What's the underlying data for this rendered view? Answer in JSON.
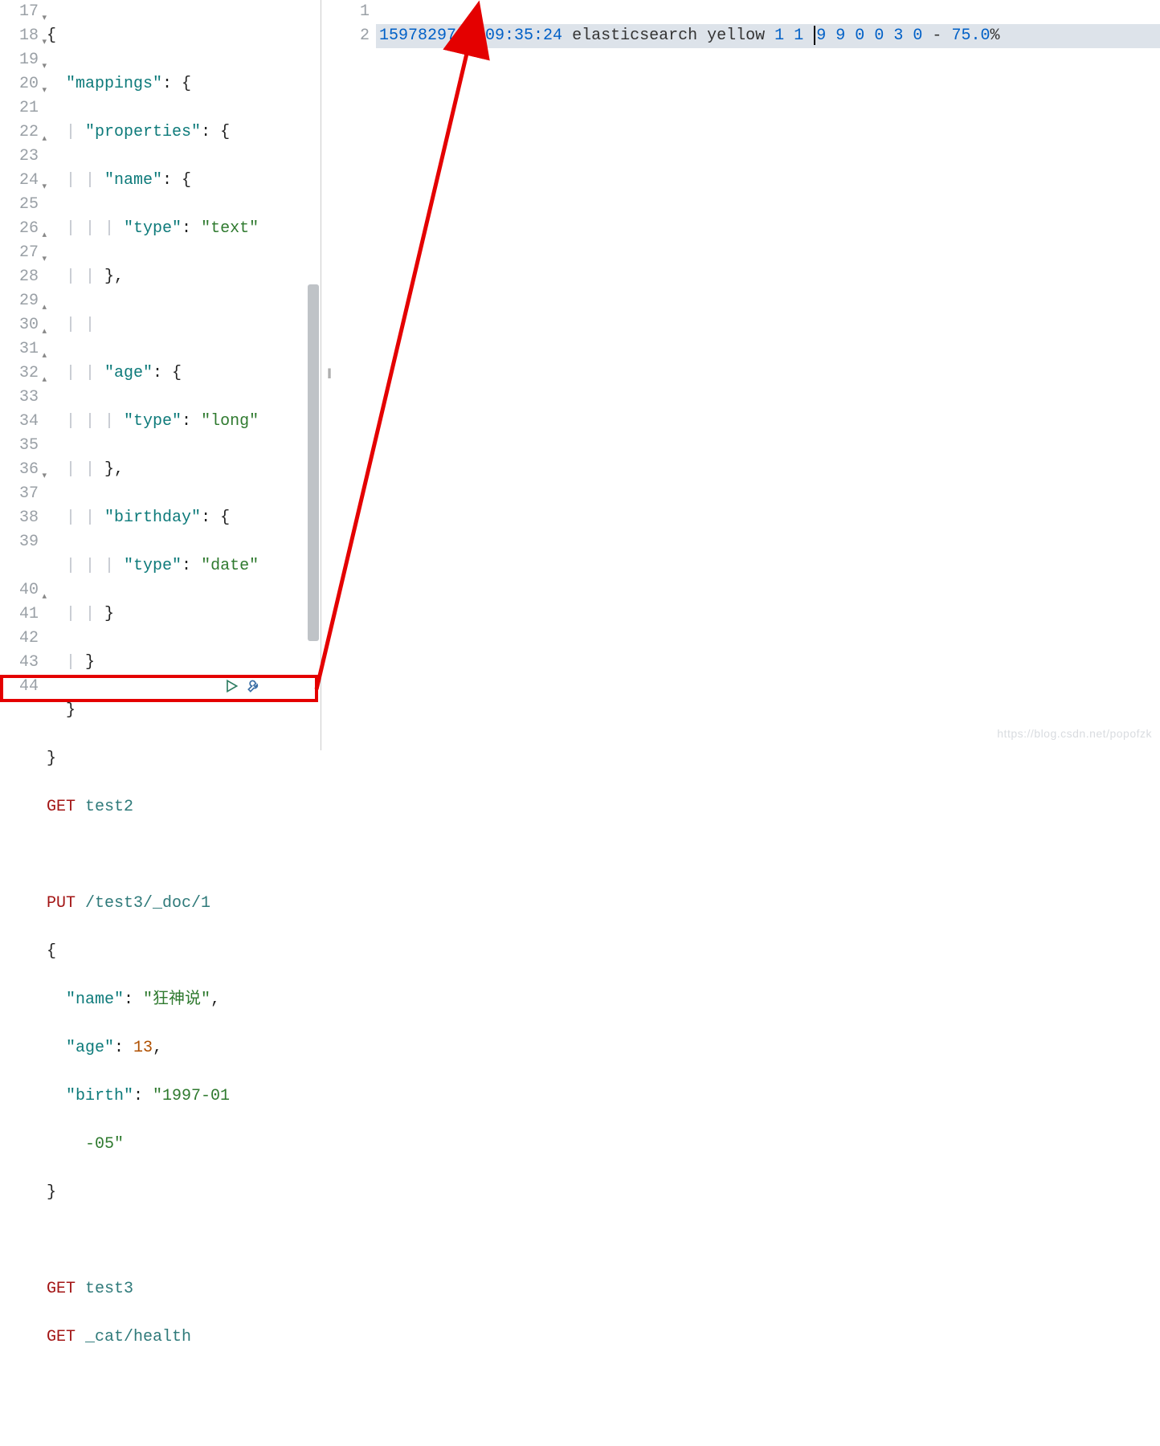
{
  "left": {
    "gutter": [
      {
        "n": "17",
        "fold": "▾"
      },
      {
        "n": "18",
        "fold": "▾"
      },
      {
        "n": "19",
        "fold": "▾"
      },
      {
        "n": "20",
        "fold": "▾"
      },
      {
        "n": "21",
        "fold": ""
      },
      {
        "n": "22",
        "fold": "▴"
      },
      {
        "n": "23",
        "fold": ""
      },
      {
        "n": "24",
        "fold": "▾"
      },
      {
        "n": "25",
        "fold": ""
      },
      {
        "n": "26",
        "fold": "▴"
      },
      {
        "n": "27",
        "fold": "▾"
      },
      {
        "n": "28",
        "fold": ""
      },
      {
        "n": "29",
        "fold": "▴"
      },
      {
        "n": "30",
        "fold": "▴"
      },
      {
        "n": "31",
        "fold": "▴"
      },
      {
        "n": "32",
        "fold": "▴"
      },
      {
        "n": "33",
        "fold": ""
      },
      {
        "n": "34",
        "fold": ""
      },
      {
        "n": "35",
        "fold": ""
      },
      {
        "n": "36",
        "fold": "▾"
      },
      {
        "n": "37",
        "fold": ""
      },
      {
        "n": "38",
        "fold": ""
      },
      {
        "n": "39",
        "fold": ""
      },
      {
        "n": "",
        "fold": ""
      },
      {
        "n": "40",
        "fold": "▴"
      },
      {
        "n": "41",
        "fold": ""
      },
      {
        "n": "42",
        "fold": ""
      },
      {
        "n": "43",
        "fold": ""
      },
      {
        "n": "44",
        "fold": ""
      }
    ],
    "code": {
      "l17": "{",
      "l18_key": "\"mappings\"",
      "l18_rest": ": {",
      "l19_key": "\"properties\"",
      "l19_rest": ": {",
      "l20_key": "\"name\"",
      "l20_rest": ": {",
      "l21_key": "\"type\"",
      "l21_rest": ": ",
      "l21_val": "\"text\"",
      "l22": "},",
      "l24_key": "\"age\"",
      "l24_rest": ": {",
      "l25_key": "\"type\"",
      "l25_rest": ": ",
      "l25_val": "\"long\"",
      "l26": "},",
      "l27_key": "\"birthday\"",
      "l27_rest": ": {",
      "l28_key": "\"type\"",
      "l28_rest": ": ",
      "l28_val": "\"date\"",
      "l29": "}",
      "l30": "}",
      "l31": "}",
      "l32": "}",
      "l33_method": "GET",
      "l33_path": " test2",
      "l35_method": "PUT",
      "l35_path": " /test3/_doc/1",
      "l36": "{",
      "l37_key": "\"name\"",
      "l37_rest": ": ",
      "l37_val": "\"狂神说\"",
      "l37_comma": ",",
      "l38_key": "\"age\"",
      "l38_rest": ": ",
      "l38_val": "13",
      "l38_comma": ",",
      "l39_key": "\"birth\"",
      "l39_rest": ": ",
      "l39_val": "\"1997-01",
      "l39b_val": "-05\"",
      "l40": "}",
      "l42_method": "GET",
      "l42_path": " test3",
      "l43_method": "GET",
      "l43_path": " _cat/health"
    }
  },
  "right": {
    "gutter": [
      "1",
      "2"
    ],
    "response": {
      "epoch": "1597829724",
      "time": "09:35:24",
      "cluster": "elasticsearch",
      "status": "yellow",
      "n1": "1",
      "n2": "1",
      "n3": "9",
      "n4": "9",
      "n5": "0",
      "n6": "0",
      "n7": "3",
      "n8": "0",
      "dash": "-",
      "pct": "75.0",
      "pctsym": "%"
    }
  },
  "watermark": "https://blog.csdn.net/popofzk"
}
